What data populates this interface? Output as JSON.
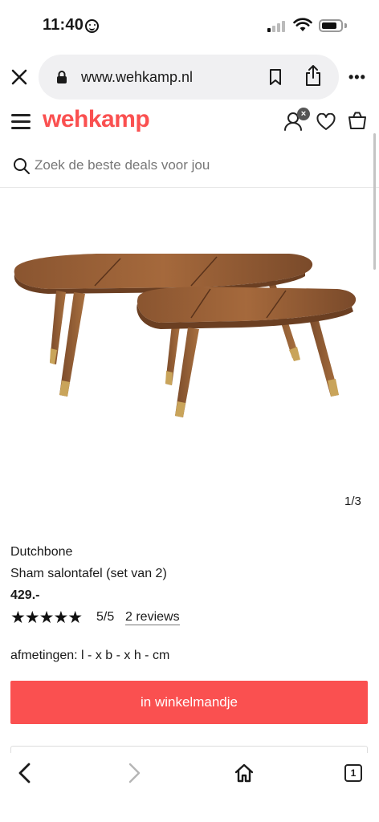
{
  "status_bar": {
    "time": "11:40",
    "battery_level": 0.8
  },
  "browser": {
    "url": "www.wehkamp.nl",
    "more_label": "•••",
    "tab_count": "1"
  },
  "site": {
    "logo": "wehkamp",
    "account_badge": "×",
    "search_placeholder": "Zoek de beste deals voor jou"
  },
  "product": {
    "image_counter": "1/3",
    "brand": "Dutchbone",
    "name": "Sham salontafel (set van 2)",
    "price": "429.-",
    "stars": "★★★★★",
    "rating_value": 5,
    "rating_text": "5/5",
    "reviews_link": "2 reviews",
    "dimensions": "afmetingen: l - x b - x h - cm",
    "cart_button": "in winkelmandje"
  },
  "colors": {
    "brand_accent": "#fa5050",
    "text": "#1a1a1a",
    "search_bg": "#f0f0f2",
    "wood_dark": "#7a4a2a",
    "wood_light": "#a8703f",
    "brass": "#c9a45a"
  },
  "icons": {
    "status": [
      "emoji-smile-icon",
      "signal-icon",
      "wifi-icon",
      "battery-icon"
    ],
    "browser": [
      "close-icon",
      "lock-icon",
      "bookmark-icon",
      "share-icon",
      "more-icon",
      "back-icon",
      "forward-icon",
      "home-icon",
      "tabs-icon"
    ],
    "site": [
      "hamburger-icon",
      "account-icon",
      "heart-icon",
      "bag-icon",
      "search-icon"
    ]
  }
}
